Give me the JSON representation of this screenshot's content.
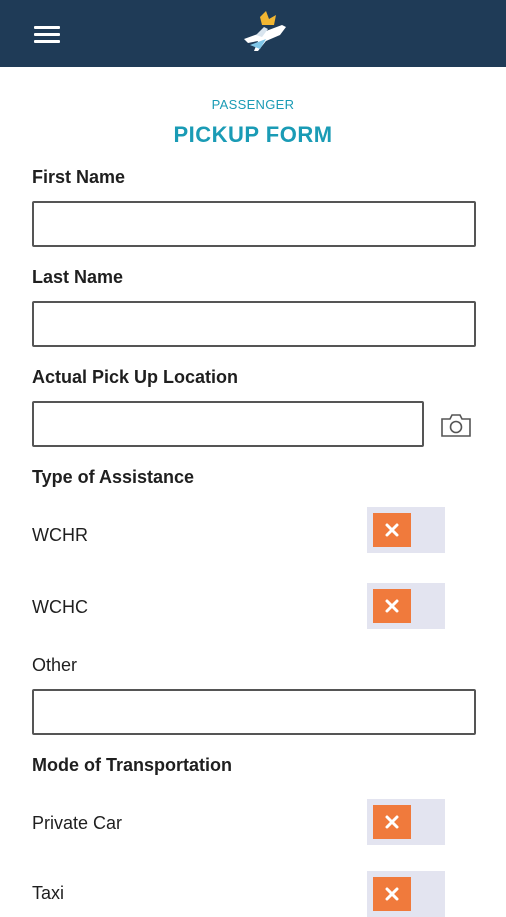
{
  "header": {
    "menu_icon": "hamburger-menu-icon",
    "logo": "airline-logo",
    "bg_color": "#1f3b57"
  },
  "form": {
    "subtitle": "PASSENGER",
    "title": "PICKUP FORM",
    "accent_color": "#1a9bb5",
    "first_name": {
      "label": "First Name",
      "value": ""
    },
    "last_name": {
      "label": "Last Name",
      "value": ""
    },
    "pickup_location": {
      "label": "Actual Pick Up Location",
      "value": "",
      "icon": "camera-icon"
    },
    "assistance": {
      "heading": "Type of Assistance",
      "options": [
        {
          "label": "WCHR",
          "checked": false
        },
        {
          "label": "WCHC",
          "checked": false
        }
      ],
      "other_label": "Other",
      "other_value": ""
    },
    "transportation": {
      "heading": "Mode of Transportation",
      "options": [
        {
          "label": "Private Car",
          "checked": false
        },
        {
          "label": "Taxi",
          "checked": false
        }
      ]
    },
    "toggle_off_color": "#f07a3c"
  }
}
